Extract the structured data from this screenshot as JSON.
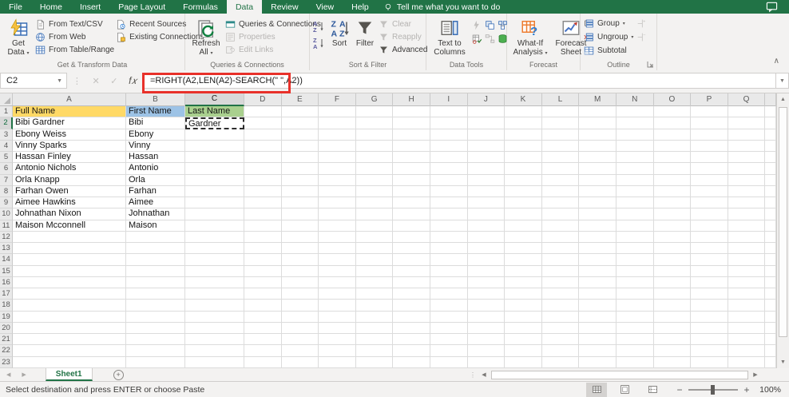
{
  "tabbar": {
    "tabs": [
      "File",
      "Home",
      "Insert",
      "Page Layout",
      "Formulas",
      "Data",
      "Review",
      "View",
      "Help"
    ],
    "selected_tab": "Data",
    "tell_me": "Tell me what you want to do"
  },
  "ribbon": {
    "get_transform": {
      "label": "Get & Transform Data",
      "get_data": "Get Data",
      "from_text_csv": "From Text/CSV",
      "from_web": "From Web",
      "from_table_range": "From Table/Range",
      "recent_sources": "Recent Sources",
      "existing_connections": "Existing Connections"
    },
    "queries": {
      "label": "Queries & Connections",
      "refresh_all": "Refresh All",
      "queries_connections": "Queries & Connections",
      "properties": "Properties",
      "edit_links": "Edit Links"
    },
    "sort_filter": {
      "label": "Sort & Filter",
      "sort": "Sort",
      "filter": "Filter",
      "clear": "Clear",
      "reapply": "Reapply",
      "advanced": "Advanced"
    },
    "data_tools": {
      "label": "Data Tools",
      "text_to_columns": "Text to Columns"
    },
    "forecast": {
      "label": "Forecast",
      "what_if": "What-If Analysis",
      "forecast_sheet": "Forecast Sheet"
    },
    "outline": {
      "label": "Outline",
      "group": "Group",
      "ungroup": "Ungroup",
      "subtotal": "Subtotal"
    }
  },
  "formula_bar": {
    "name_box": "C2",
    "formula": "=RIGHT(A2,LEN(A2)-SEARCH(\" \",A2))"
  },
  "sheet": {
    "columns": [
      "A",
      "B",
      "C",
      "D",
      "E",
      "F",
      "G",
      "H",
      "I",
      "J",
      "K",
      "L",
      "M",
      "N",
      "O",
      "P",
      "Q"
    ],
    "col_widths": {
      "rowheader": 16,
      "A": 142,
      "B": 74,
      "C": 74,
      "default": 46.6,
      "filler": 13.6
    },
    "row_count": 23,
    "active_column": "C",
    "active_row": 2,
    "selected_cell": "C2",
    "copied_cell": "C2",
    "fills": {
      "A1": "#FFD966",
      "B1": "#9DC3E6",
      "C1": "#A9D08E"
    },
    "cells": {
      "A1": "Full Name",
      "B1": "First Name",
      "C1": "Last Name",
      "A2": "Bibi Gardner",
      "B2": "Bibi",
      "C2": "Gardner",
      "A3": "Ebony Weiss",
      "B3": "Ebony",
      "A4": "Vinny Sparks",
      "B4": "Vinny",
      "A5": "Hassan Finley",
      "B5": "Hassan",
      "A6": "Antonio Nichols",
      "B6": "Antonio",
      "A7": "Orla Knapp",
      "B7": "Orla",
      "A8": "Farhan Owen",
      "B8": "Farhan",
      "A9": "Aimee Hawkins",
      "B9": "Aimee",
      "A10": "Johnathan Nixon",
      "B10": "Johnathan",
      "A11": "Maison Mcconnell",
      "B11": "Maison"
    }
  },
  "sheetbar": {
    "sheet_tab": "Sheet1"
  },
  "status_bar": {
    "message": "Select destination and press ENTER or choose Paste",
    "zoom": "100%"
  },
  "colors": {
    "excel_green": "#217346",
    "annotation_red": "#e8312a",
    "fill_yellow": "#FFD966",
    "fill_blue": "#9DC3E6",
    "fill_green": "#A9D08E"
  }
}
